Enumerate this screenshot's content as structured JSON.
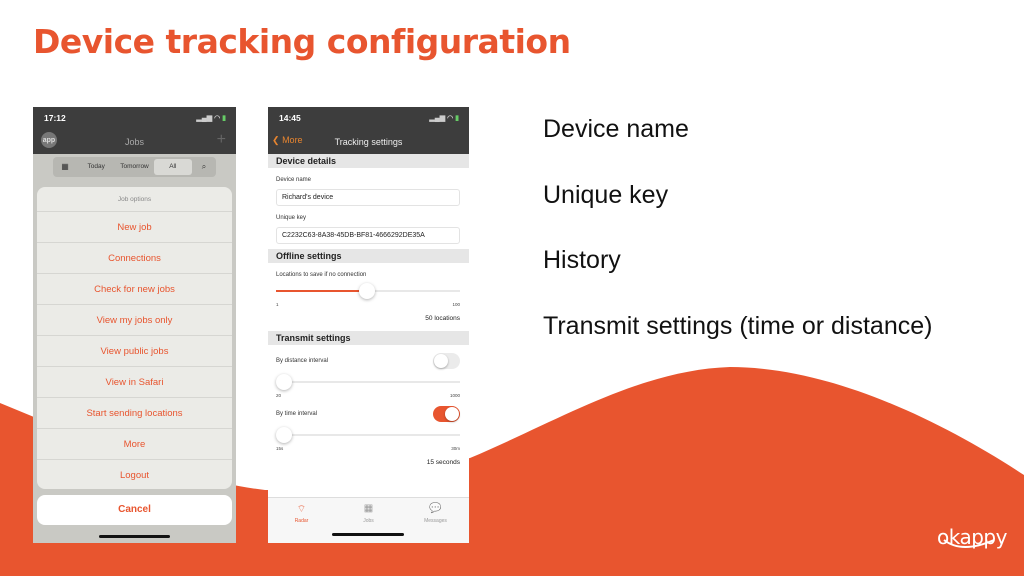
{
  "slide": {
    "title": "Device tracking configuration",
    "bullets": [
      "Device name",
      "Unique key",
      "History",
      "Transmit settings (time or distance)"
    ],
    "logo_text": "okappy",
    "accent_color": "#e8552f"
  },
  "phone1": {
    "status_time": "17:12",
    "nav_title": "Jobs",
    "avatar_text": "app",
    "segments": [
      {
        "label": "calendar-icon",
        "glyph": "▦"
      },
      {
        "label": "Today"
      },
      {
        "label": "Tomorrow"
      },
      {
        "label": "All",
        "active": true
      },
      {
        "label": "search-icon",
        "glyph": "⌕"
      }
    ],
    "sheet": {
      "title": "Job options",
      "items": [
        "New job",
        "Connections",
        "Check for new jobs",
        "View my jobs only",
        "View public jobs",
        "View in Safari",
        "Start sending locations",
        "More",
        "Logout"
      ],
      "cancel": "Cancel"
    }
  },
  "phone2": {
    "status_time": "14:45",
    "back_label": "More",
    "nav_title": "Tracking settings",
    "device_details": {
      "heading": "Device details",
      "device_name_label": "Device name",
      "device_name_value": "Richard's device",
      "unique_key_label": "Unique key",
      "unique_key_value": "C2232C63-8A38-45DB-BF81-4666292DE35A"
    },
    "offline": {
      "heading": "Offline settings",
      "label": "Locations to save if no connection",
      "min": "1",
      "max": "100",
      "value": 50,
      "value_text": "50 locations"
    },
    "transmit": {
      "heading": "Transmit settings",
      "distance_label": "By distance interval",
      "distance_enabled": false,
      "distance_min": "20",
      "distance_max": "1000",
      "distance_fraction": 0,
      "time_label": "By time interval",
      "time_enabled": true,
      "time_min": "15s",
      "time_max": "30m",
      "time_fraction": 0,
      "time_value_text": "15 seconds"
    },
    "tabs": [
      {
        "label": "Radar",
        "glyph": "⌔",
        "active": true
      },
      {
        "label": "Jobs",
        "glyph": "▦",
        "active": false
      },
      {
        "label": "Messages",
        "glyph": "💬",
        "active": false
      }
    ]
  }
}
